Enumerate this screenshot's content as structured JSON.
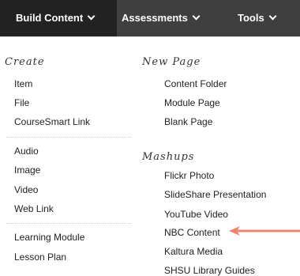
{
  "toolbar": {
    "build_content": "Build Content",
    "assessments": "Assessments",
    "tools": "Tools"
  },
  "left": {
    "heading": "Create",
    "items": [
      "Item",
      "File",
      "CourseSmart Link",
      "Audio",
      "Image",
      "Video",
      "Web Link",
      "Learning Module",
      "Lesson Plan"
    ]
  },
  "right": {
    "new_page_heading": "New Page",
    "new_page_items": [
      "Content Folder",
      "Module Page",
      "Blank Page"
    ],
    "mashups_heading": "Mashups",
    "mashups_items": [
      "Flickr Photo",
      "SlideShare Presentation",
      "YouTube Video",
      "NBC Content",
      "Kaltura Media",
      "SHSU Library Guides"
    ]
  },
  "colors": {
    "toolbar_bg": "#3f3f3f",
    "active_tab_bg": "#222222",
    "arrow": "#e8876b"
  }
}
